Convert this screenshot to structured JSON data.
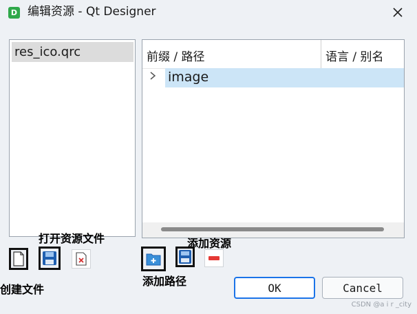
{
  "window": {
    "app_icon_letter": "D",
    "title": "编辑资源 - Qt Designer"
  },
  "resource_files": {
    "items": [
      "res_ico.qrc"
    ]
  },
  "tree": {
    "headers": [
      "前缀 / 路径",
      "语言 / 别名"
    ],
    "rows": [
      {
        "label": "image",
        "expanded": false,
        "selected": true
      }
    ]
  },
  "annotations": {
    "create_file": "创建文件",
    "open_file": "打开资源文件",
    "add_path": "添加路径",
    "add_resource": "添加资源"
  },
  "buttons": {
    "ok": "OK",
    "cancel": "Cancel"
  },
  "watermark": "CSDN @a i r _city",
  "colors": {
    "accent": "#1a73e8",
    "selection": "#cce5f7",
    "app_icon": "#2fa84a"
  }
}
